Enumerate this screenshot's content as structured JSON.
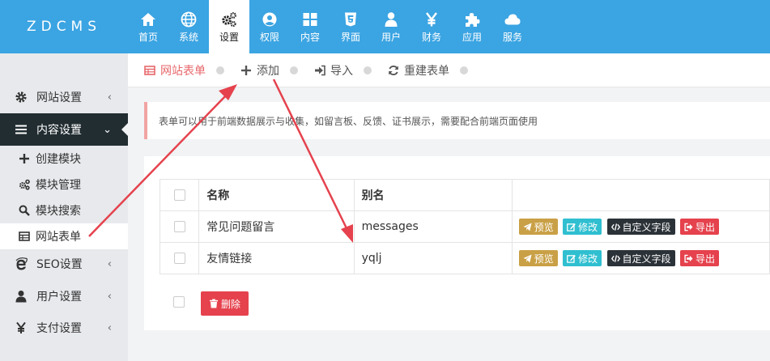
{
  "app": {
    "logo": "ZDCMS"
  },
  "topnav": [
    {
      "id": "home",
      "label": "首页",
      "icon": "home-icon"
    },
    {
      "id": "system",
      "label": "系统",
      "icon": "globe-icon"
    },
    {
      "id": "settings",
      "label": "设置",
      "icon": "cogs-icon",
      "active": true
    },
    {
      "id": "permissions",
      "label": "权限",
      "icon": "user-circle-icon"
    },
    {
      "id": "content",
      "label": "内容",
      "icon": "grid-icon"
    },
    {
      "id": "interface",
      "label": "界面",
      "icon": "html5-icon"
    },
    {
      "id": "users",
      "label": "用户",
      "icon": "user-icon"
    },
    {
      "id": "finance",
      "label": "财务",
      "icon": "yen-icon"
    },
    {
      "id": "apps",
      "label": "应用",
      "icon": "puzzle-icon"
    },
    {
      "id": "services",
      "label": "服务",
      "icon": "cloud-icon"
    }
  ],
  "sidebar": {
    "groups": [
      {
        "label": "网站设置",
        "icon": "gear-icon",
        "chevron": "‹"
      },
      {
        "label": "内容设置",
        "icon": "bars-icon",
        "chevron": "⌄",
        "active": true
      },
      {
        "label": "SEO设置",
        "icon": "ie-icon",
        "chevron": "‹"
      },
      {
        "label": "用户设置",
        "icon": "user-icon",
        "chevron": "‹"
      },
      {
        "label": "支付设置",
        "icon": "yen-icon",
        "chevron": "‹"
      }
    ],
    "subitems": [
      {
        "label": "创建模块",
        "icon": "plus-icon"
      },
      {
        "label": "模块管理",
        "icon": "cogs-icon"
      },
      {
        "label": "模块搜索",
        "icon": "search-icon"
      },
      {
        "label": "网站表单",
        "icon": "table-icon",
        "current": true
      }
    ]
  },
  "tabs": [
    {
      "label": "网站表单",
      "icon": "table-icon",
      "active": true
    },
    {
      "label": "添加",
      "icon": "plus-icon"
    },
    {
      "label": "导入",
      "icon": "sign-in-icon"
    },
    {
      "label": "重建表单",
      "icon": "refresh-icon"
    }
  ],
  "notice": "表单可以用于前端数据展示与收集，如留言板、反馈、证书展示，需要配合前端页面使用",
  "table": {
    "columns": [
      "名称",
      "别名"
    ],
    "rows": [
      {
        "name": "常见问题留言",
        "alias": "messages"
      },
      {
        "name": "友情链接",
        "alias": "yqlj"
      }
    ],
    "actions": {
      "preview": "预览",
      "edit": "修改",
      "custom_fields": "自定义字段",
      "export": "导出"
    }
  },
  "footer": {
    "delete_label": "删除"
  },
  "colors": {
    "header": "#3ba4e2",
    "sidebar_active": "#222d32",
    "tab_active": "#e8676b",
    "preview": "#c9a046",
    "edit": "#2fbfd0",
    "custom": "#2b3238",
    "danger": "#e5424d",
    "annotation_arrow": "#e5424d"
  }
}
